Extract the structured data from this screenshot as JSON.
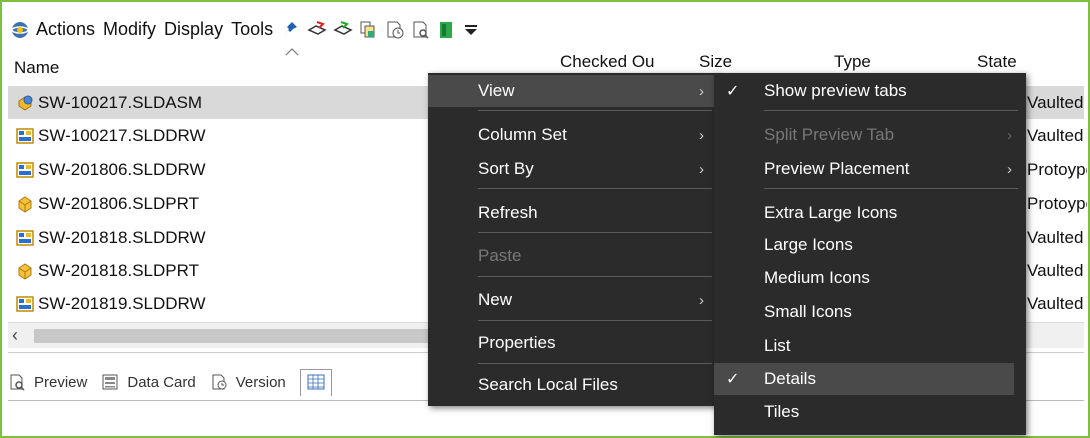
{
  "toolbar": {
    "menus": [
      "Actions",
      "Modify",
      "Display",
      "Tools"
    ]
  },
  "columns": {
    "name": "Name",
    "checked_out": "Checked Ou",
    "size": "Size",
    "type": "Type",
    "state": "State"
  },
  "files": [
    {
      "name": "SW-100217.SLDASM",
      "icon": "assembly-icon",
      "state": "Vaulted",
      "selected": true
    },
    {
      "name": "SW-100217.SLDDRW",
      "icon": "drawing-icon",
      "state": "Vaulted"
    },
    {
      "name": "SW-201806.SLDDRW",
      "icon": "drawing-icon",
      "state": "Protoype"
    },
    {
      "name": "SW-201806.SLDPRT",
      "icon": "part-icon",
      "state": "Protoype"
    },
    {
      "name": "SW-201818.SLDDRW",
      "icon": "drawing-icon",
      "state": "Vaulted"
    },
    {
      "name": "SW-201818.SLDPRT",
      "icon": "part-icon",
      "state": "Vaulted"
    },
    {
      "name": "SW-201819.SLDDRW",
      "icon": "drawing-icon",
      "state": "Vaulted"
    }
  ],
  "bottom_tabs": [
    {
      "label": "Preview",
      "icon": "preview-icon"
    },
    {
      "label": "Data Card",
      "icon": "data-card-icon"
    },
    {
      "label": "Version",
      "icon": "version-icon"
    }
  ],
  "context_menu": {
    "items": [
      {
        "label": "View",
        "submenu": true,
        "hover": true
      },
      {
        "label": "Column Set",
        "submenu": true
      },
      {
        "label": "Sort By",
        "submenu": true
      },
      {
        "label": "Refresh"
      },
      {
        "label": "Paste",
        "disabled": true
      },
      {
        "label": "New",
        "submenu": true
      },
      {
        "label": "Properties"
      },
      {
        "label": "Search Local Files"
      }
    ]
  },
  "view_submenu": {
    "items": [
      {
        "label": "Show preview tabs",
        "checked": true
      },
      {
        "label": "Split Preview Tab",
        "disabled": true,
        "submenu": true
      },
      {
        "label": "Preview Placement",
        "submenu": true
      },
      {
        "label": "Extra Large Icons"
      },
      {
        "label": "Large Icons"
      },
      {
        "label": "Medium Icons"
      },
      {
        "label": "Small Icons"
      },
      {
        "label": "List"
      },
      {
        "label": "Details",
        "checked": true,
        "hover": true
      },
      {
        "label": "Tiles"
      }
    ]
  },
  "colors": {
    "frame_border": "#7fbf3f",
    "menu_bg": "#2b2b2b",
    "menu_hover": "#4a4a4a",
    "selected_row": "#d9d9d9"
  }
}
